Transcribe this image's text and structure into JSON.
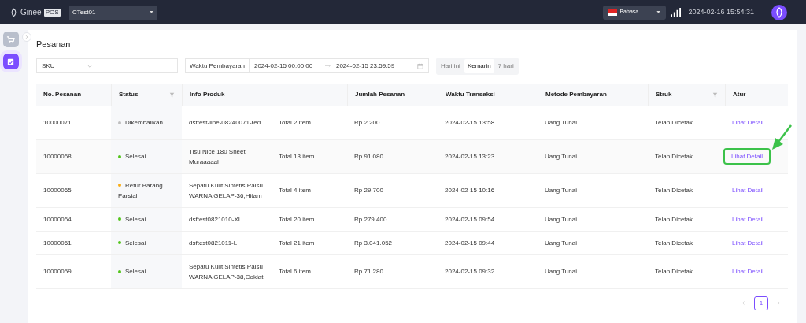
{
  "top_bar": {
    "logo": {
      "name": "Ginee",
      "badge": "POS"
    },
    "store_select": "CTest01",
    "language": "Bahasa",
    "datetime": "2024-02-16 15:54:31"
  },
  "sidebar": {
    "items": [
      {
        "kind": "cart",
        "selected": false
      },
      {
        "kind": "orders",
        "selected": true
      }
    ]
  },
  "page_title": "Pesanan",
  "filters": {
    "search_type": "SKU",
    "date_label": "Waktu Pembayaran",
    "date_start": "2024-02-15 00:00:00",
    "date_end": "2024-02-15 23:59:59",
    "quick_ranges": [
      {
        "label": "Hari ini",
        "selected": false
      },
      {
        "label": "Kemarin",
        "selected": true
      },
      {
        "label": "7 hari",
        "selected": false
      }
    ]
  },
  "table": {
    "columns": [
      {
        "label": "No. Pesanan",
        "filter": false
      },
      {
        "label": "Status",
        "filter": true
      },
      {
        "label": "Info Produk",
        "filter": false
      },
      {
        "filter": false
      },
      {
        "label": "Jumlah Pesanan",
        "filter": false
      },
      {
        "label": "Waktu Transaksi",
        "filter": false
      },
      {
        "label": "Metode Pembayaran",
        "filter": false
      },
      {
        "label": "Struk",
        "filter": true
      },
      {
        "label": "Atur",
        "filter": false
      }
    ],
    "rows": [
      {
        "order_no": "10000071",
        "status": "Dikembalikan",
        "color": "#bfbfbf",
        "product": "dsftest-line-08240071-red",
        "total": "Total 2 item",
        "amount": "Rp 2.200",
        "time": "2024-02-15 13:58",
        "method": "Uang Tunai",
        "receipt": "Telah Dicetak",
        "action": "Lihat Detail",
        "highlighted": false
      },
      {
        "order_no": "10000068",
        "status": "Selesai",
        "color": "#52c41a",
        "product": "Tisu Nice 180 Sheet Muraaaaah",
        "total": "Total 13 item",
        "amount": "Rp 91.080",
        "time": "2024-02-15 13:23",
        "method": "Uang Tunai",
        "receipt": "Telah Dicetak",
        "action": "Lihat Detail",
        "highlighted": true
      },
      {
        "order_no": "10000065",
        "status": "Retur Barang Parsial",
        "color": "#faad14",
        "product": "Sepatu Kulit Sintetis Palsu WARNA GELAP-36,Hitam",
        "total": "Total 4 item",
        "amount": "Rp 29.700",
        "time": "2024-02-15 10:16",
        "method": "Uang Tunai",
        "receipt": "Telah Dicetak",
        "action": "Lihat Detail",
        "highlighted": false
      },
      {
        "order_no": "10000064",
        "status": "Selesai",
        "color": "#52c41a",
        "product": "dsftest0821010-XL",
        "total": "Total 20 item",
        "amount": "Rp 279.400",
        "time": "2024-02-15 09:54",
        "method": "Uang Tunai",
        "receipt": "Telah Dicetak",
        "action": "Lihat Detail",
        "highlighted": false
      },
      {
        "order_no": "10000061",
        "status": "Selesai",
        "color": "#52c41a",
        "product": "dsftest0821011-L",
        "total": "Total 21 item",
        "amount": "Rp 3.041.052",
        "time": "2024-02-15 09:44",
        "method": "Uang Tunai",
        "receipt": "Telah Dicetak",
        "action": "Lihat Detail",
        "highlighted": false
      },
      {
        "order_no": "10000059",
        "status": "Selesai",
        "color": "#52c41a",
        "product": "Sepatu Kulit Sintetis Palsu WARNA GELAP-38,Coklat",
        "total": "Total 6 item",
        "amount": "Rp 71.280",
        "time": "2024-02-15 09:32",
        "method": "Uang Tunai",
        "receipt": "Telah Dicetak",
        "action": "Lihat Detail",
        "highlighted": false
      }
    ]
  },
  "pagination": {
    "pages": [
      {
        "label": "1",
        "selected": true
      }
    ]
  }
}
